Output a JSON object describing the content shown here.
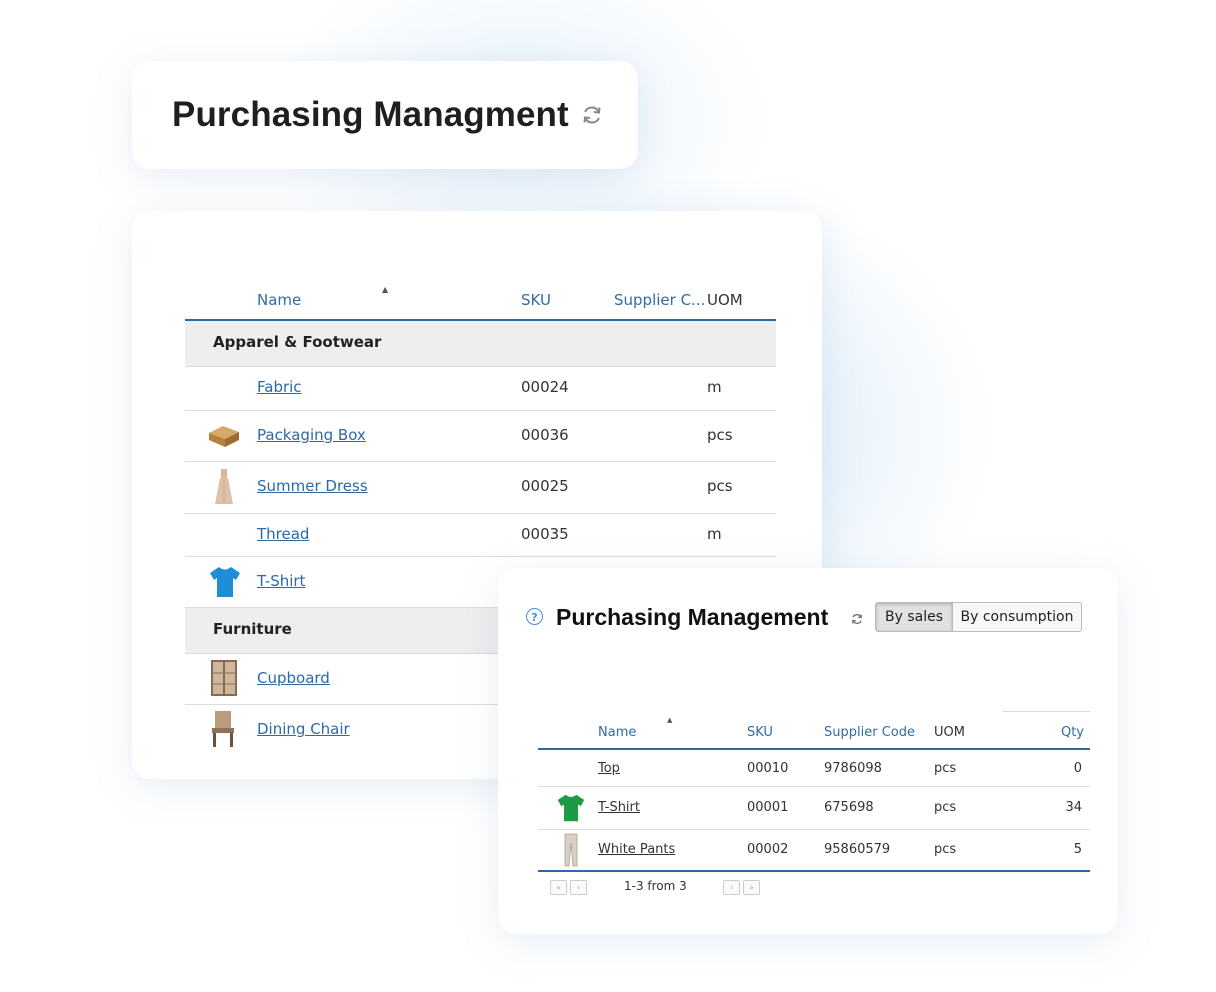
{
  "header": {
    "title": "Purchasing Managment"
  },
  "main_table": {
    "columns": {
      "name": "Name",
      "sku": "SKU",
      "supplier": "Supplier C...",
      "uom": "UOM"
    },
    "groups": [
      {
        "label": "Apparel & Footwear"
      },
      {
        "label": "Furniture"
      }
    ],
    "rows": [
      {
        "name": "Fabric",
        "sku": "00024",
        "uom": "m"
      },
      {
        "name": "Packaging Box",
        "sku": "00036",
        "uom": "pcs"
      },
      {
        "name": "Summer Dress",
        "sku": "00025",
        "uom": "pcs"
      },
      {
        "name": "Thread",
        "sku": "00035",
        "uom": "m"
      },
      {
        "name": "T-Shirt"
      },
      {
        "name": "Cupboard"
      },
      {
        "name": "Dining Chair"
      }
    ]
  },
  "panel": {
    "help": "?",
    "title": "Purchasing Management",
    "toggle": {
      "by_sales": "By sales",
      "by_consumption": "By consumption",
      "selected": "By sales"
    },
    "columns": {
      "name": "Name",
      "sku": "SKU",
      "supplier": "Supplier Code",
      "uom": "UOM",
      "qty": "Qty"
    },
    "rows": [
      {
        "name": "Top",
        "sku": "00010",
        "supplier": "9786098",
        "uom": "pcs",
        "qty": "0"
      },
      {
        "name": "T-Shirt",
        "sku": "00001",
        "supplier": "675698",
        "uom": "pcs",
        "qty": "34"
      },
      {
        "name": "White Pants",
        "sku": "00002",
        "supplier": "95860579",
        "uom": "pcs",
        "qty": "5"
      }
    ],
    "pager": {
      "first": "«",
      "prev": "‹",
      "next": "›",
      "last": "»",
      "info": "1-3 from 3"
    }
  },
  "colors": {
    "link": "#2d6aa5",
    "header_rule": "#2a6aa6",
    "group_bg": "#eeeeee",
    "tshirt_main": "#1e8fd6",
    "tshirt_panel": "#1c9a44"
  }
}
